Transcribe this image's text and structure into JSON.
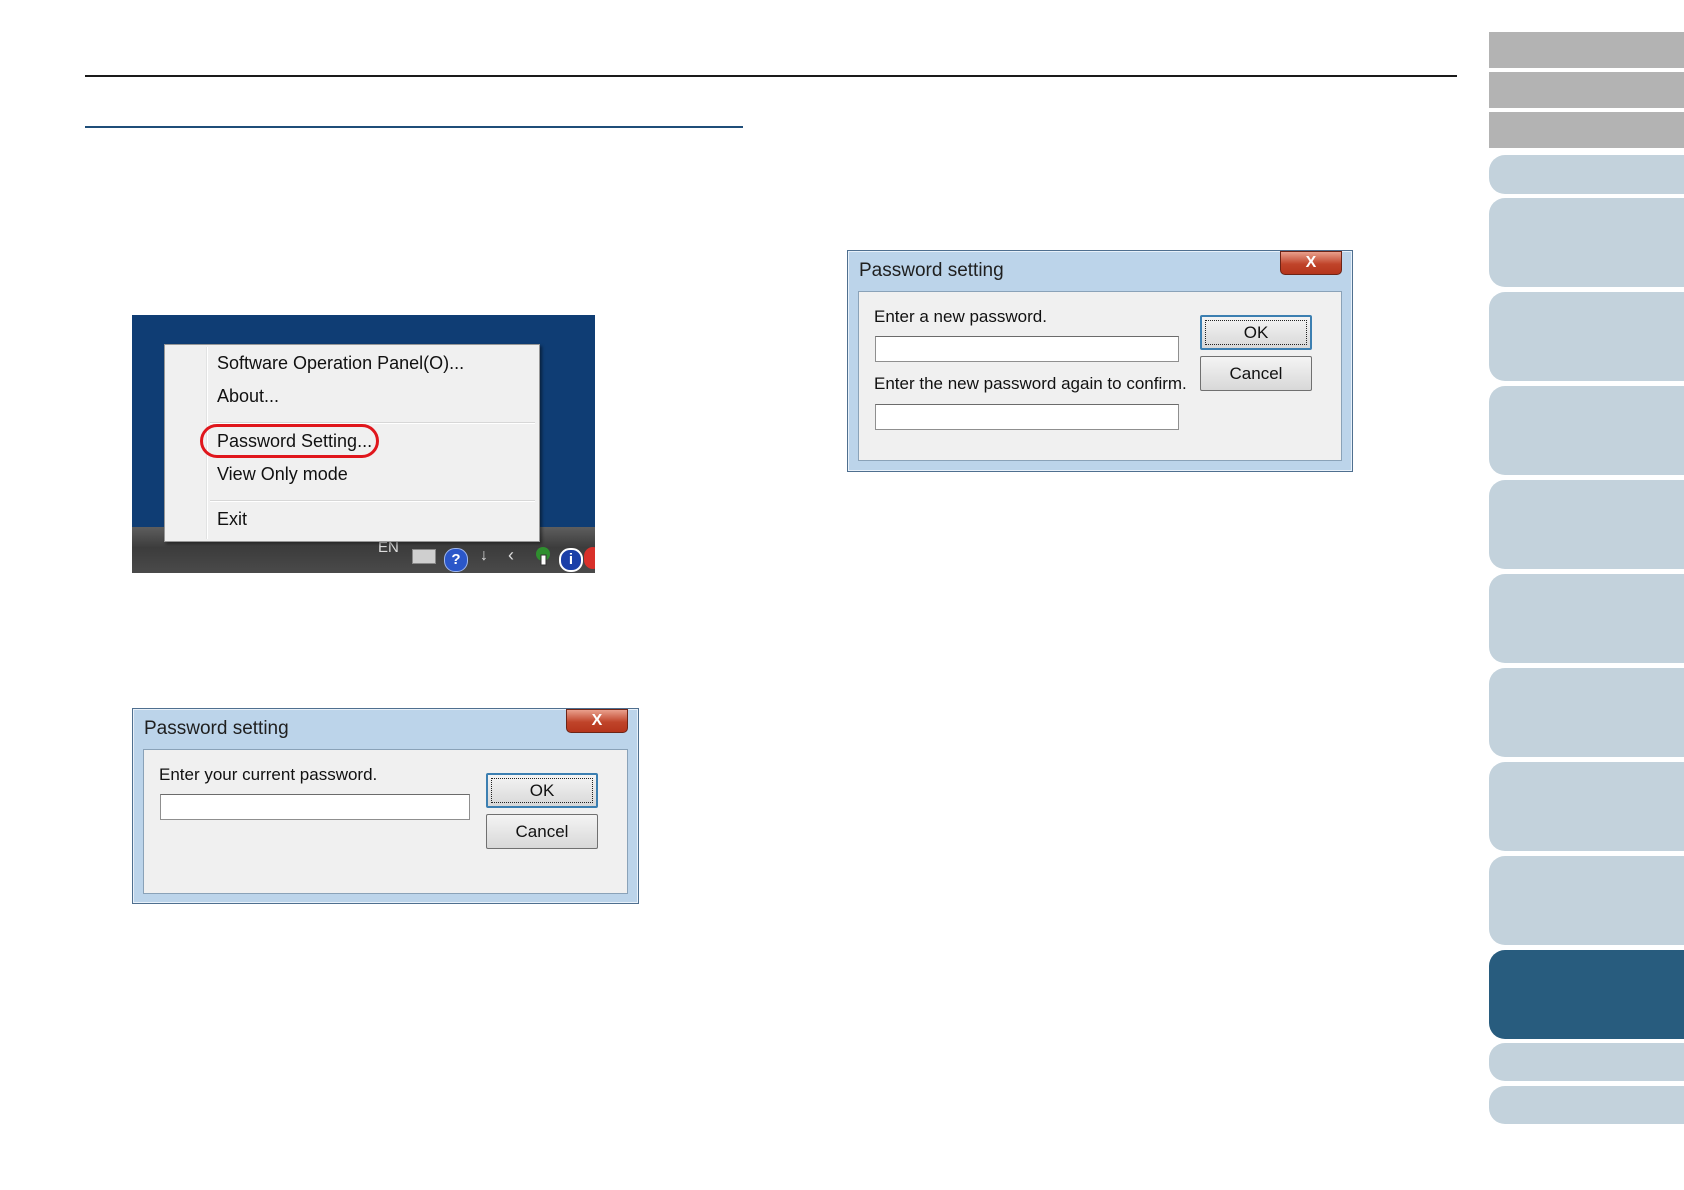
{
  "context_menu": {
    "items": [
      "Software Operation Panel(O)...",
      "About...",
      "Password Setting...",
      "View Only mode",
      "Exit"
    ],
    "taskbar_lang": "EN",
    "tray_help_glyph": "?",
    "tray_info_glyph": "i"
  },
  "dialog_current": {
    "title": "Password setting",
    "close_glyph": "X",
    "prompt": "Enter your current password.",
    "ok_label": "OK",
    "cancel_label": "Cancel"
  },
  "dialog_new": {
    "title": "Password setting",
    "close_glyph": "X",
    "prompt_new": "Enter a new password.",
    "prompt_confirm": "Enter the new password again to confirm.",
    "ok_label": "OK",
    "cancel_label": "Cancel"
  },
  "sidebar": {
    "active_tab_index": 10,
    "colors": {
      "gray": "#b3b3b3",
      "light": "#c3d2dc",
      "active": "#285c7e"
    }
  },
  "colors": {
    "highlight_ring": "#e0161c",
    "section_rule": "#1f4e79",
    "desktop_background": "#0f3d74"
  }
}
